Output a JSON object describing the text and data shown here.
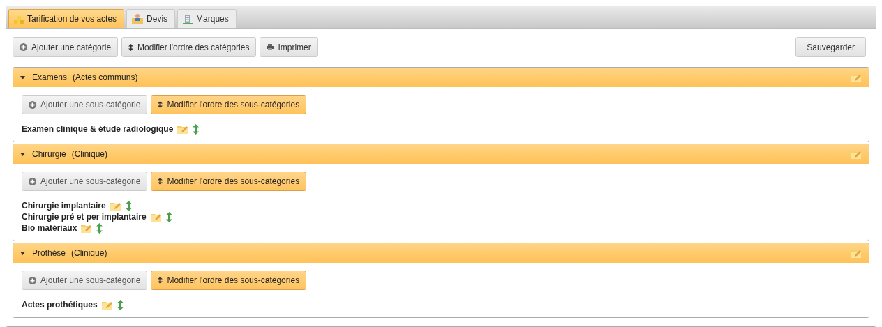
{
  "tabs": [
    {
      "label": "Tarification de vos actes",
      "kind": "coins",
      "selected": true
    },
    {
      "label": "Devis",
      "kind": "person",
      "selected": false
    },
    {
      "label": "Marques",
      "kind": "building",
      "selected": false
    }
  ],
  "toolbar": {
    "buttons": [
      {
        "label": "Ajouter une catégorie",
        "kind": "add"
      },
      {
        "label": "Modifier l'ordre des catégories",
        "kind": "reorder"
      },
      {
        "label": "Imprimer",
        "kind": "print"
      }
    ],
    "save_button": "Sauvegarder"
  },
  "categories": [
    {
      "name": "Examens",
      "group": "(Actes communs)",
      "expanded": true,
      "buttons": [
        {
          "label": "Ajouter une sous-catégorie",
          "kind": "add",
          "highlighted": false
        },
        {
          "label": "Modifier l'ordre des sous-catégories",
          "kind": "reorder",
          "highlighted": true
        }
      ],
      "subcategories": [
        "Examen clinique & étude radiologique"
      ]
    },
    {
      "name": "Chirurgie",
      "group": "(Clinique)",
      "expanded": true,
      "buttons": [
        {
          "label": "Ajouter une sous-catégorie",
          "kind": "add",
          "highlighted": false
        },
        {
          "label": "Modifier l'ordre des sous-catégories",
          "kind": "reorder",
          "highlighted": true
        }
      ],
      "subcategories": [
        "Chirurgie implantaire",
        "Chirurgie pré et per implantaire",
        "Bio matériaux"
      ]
    },
    {
      "name": "Prothèse",
      "group": "(Clinique)",
      "expanded": true,
      "buttons": [
        {
          "label": "Ajouter une sous-catégorie",
          "kind": "add",
          "highlighted": false
        },
        {
          "label": "Modifier l'ordre des sous-catégories",
          "kind": "reorder",
          "highlighted": true
        }
      ],
      "subcategories": [
        "Actes prothétiques"
      ]
    }
  ]
}
